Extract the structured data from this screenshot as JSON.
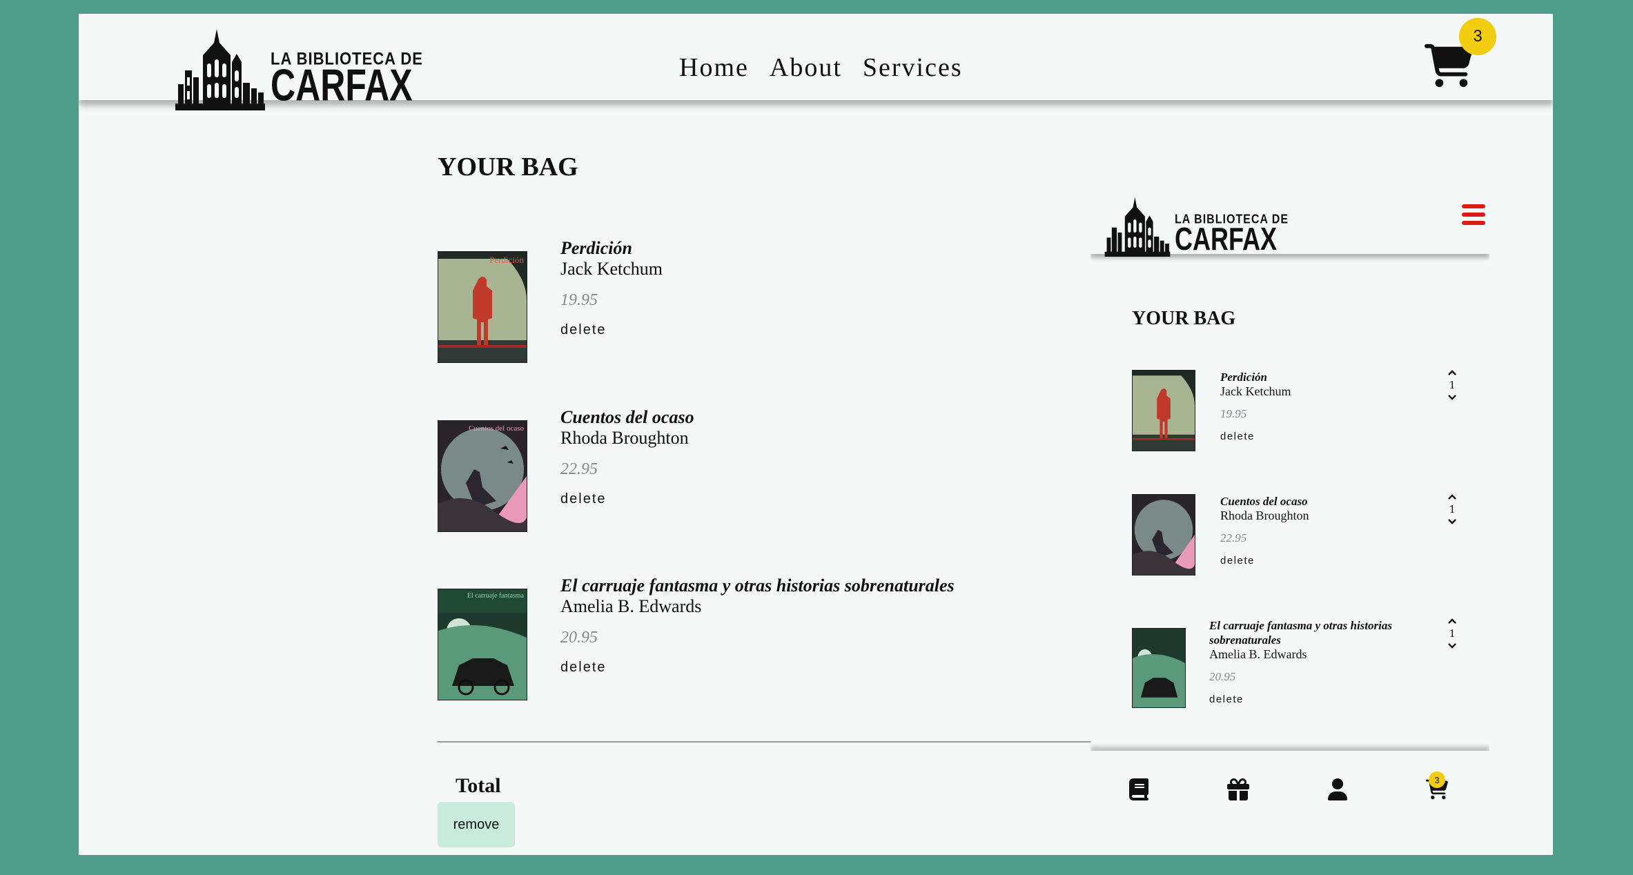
{
  "header": {
    "logo": {
      "line1": "LA BIBLIOTECA DE",
      "line2": "CARFAX"
    },
    "nav": [
      {
        "label": "Home"
      },
      {
        "label": "About"
      },
      {
        "label": "Services"
      }
    ],
    "cart_count": "3"
  },
  "bag": {
    "title": "YOUR BAG",
    "items": [
      {
        "title": "Perdición",
        "author": "Jack Ketchum",
        "price": "19.95",
        "delete_label": "delete",
        "cover_text": "Perdición",
        "cover_color": "#c0392b"
      },
      {
        "title": "Cuentos del ocaso",
        "author": "Rhoda Broughton",
        "price": "22.95",
        "delete_label": "delete",
        "cover_text": "Cuentos del ocaso",
        "cover_color": "#e89ab8"
      },
      {
        "title": "El carruaje fantasma y otras historias sobrenaturales",
        "author": "Amelia B. Edwards",
        "price": "20.95",
        "delete_label": "delete",
        "cover_text": "El carruaje fantasma",
        "cover_color": "#4a8a5a"
      }
    ],
    "total_label": "Total",
    "remove_label": "remove"
  },
  "mobile": {
    "logo": {
      "line1": "LA BIBLIOTECA DE",
      "line2": "CARFAX"
    },
    "title": "YOUR BAG",
    "items": [
      {
        "title": "Perdición",
        "author": "Jack Ketchum",
        "price": "19.95",
        "delete_label": "delete",
        "quantity": "1"
      },
      {
        "title": "Cuentos del ocaso",
        "author": "Rhoda Broughton",
        "price": "22.95",
        "delete_label": "delete",
        "quantity": "1"
      },
      {
        "title": "El carruaje fantasma y otras historias sobrenaturales",
        "author": "Amelia B. Edwards",
        "price": "20.95",
        "delete_label": "delete",
        "quantity": "1"
      }
    ],
    "footer": {
      "icons": [
        "book-icon",
        "gift-icon",
        "user-icon",
        "cart-icon"
      ],
      "cart_count": "3"
    }
  },
  "colors": {
    "background": "#4c9d8a",
    "page": "#f4f8f6",
    "badge": "#f2cc0f",
    "hamburger": "#e01818",
    "remove_button": "#c9ebdc",
    "price": "#888888"
  }
}
